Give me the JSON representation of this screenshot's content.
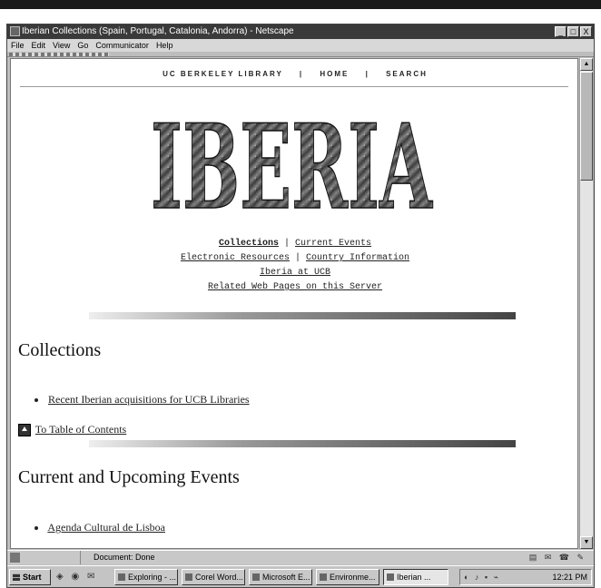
{
  "window": {
    "title": "Iberian Collections (Spain, Portugal, Catalonia, Andorra) - Netscape",
    "min_btn": "_",
    "max_btn": "□",
    "close_btn": "X"
  },
  "menu": [
    "File",
    "Edit",
    "View",
    "Go",
    "Communicator",
    "Help"
  ],
  "page": {
    "topnav": {
      "library": "UC BERKELEY LIBRARY",
      "home": "HOME",
      "search": "SEARCH",
      "separator": "|"
    },
    "banner_alt": "IBERIA",
    "links": {
      "collections": "Collections",
      "current_events": "Current Events",
      "electronic_resources": "Electronic Resources",
      "country_information": "Country Information",
      "iberia_at_ucb": "Iberia at UCB",
      "related_pages": "Related Web Pages on this Server",
      "separator": "|"
    },
    "section1": {
      "heading": "Collections",
      "item": "Recent Iberian acquisitions for UCB Libraries"
    },
    "toc_link": "To Table of Contents",
    "section2": {
      "heading": "Current and Upcoming Events",
      "item": "Agenda Cultural de Lisboa"
    }
  },
  "status": {
    "text": "Document: Done"
  },
  "taskbar": {
    "start": "Start",
    "tasks": [
      "Exploring - ...",
      "Corel Word...",
      "Microsoft E...",
      "Environme...",
      "Iberian ..."
    ],
    "clock": "12:21 PM"
  },
  "colors": {
    "titlebar": "#3a3a3a",
    "chrome": "#c0c0c0",
    "content_bg": "#ffffff"
  }
}
